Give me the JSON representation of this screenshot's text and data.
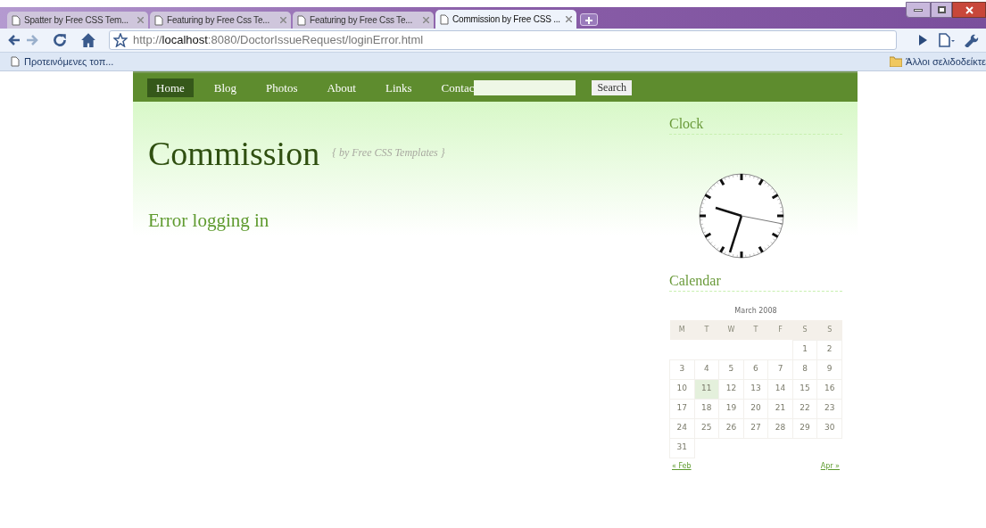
{
  "browser": {
    "tabs": [
      {
        "label": "Spatter by Free CSS Tem...",
        "selected": false
      },
      {
        "label": "Featuring by Free Css Te...",
        "selected": false
      },
      {
        "label": "Featuring by Free Css Te...",
        "selected": false
      },
      {
        "label": "Commission by Free CSS ...",
        "selected": true
      }
    ],
    "address": {
      "scheme": "http://",
      "host": "localhost",
      "rest": ":8080/DoctorIssueRequest/loginError.html"
    },
    "bookmarks": [
      {
        "label": "Προτεινόμενες τοπ..."
      }
    ],
    "other_bookmarks": "Άλλοι σελιδοδείκτε"
  },
  "page": {
    "nav": [
      {
        "label": "Home",
        "selected": true
      },
      {
        "label": "Blog",
        "selected": false
      },
      {
        "label": "Photos",
        "selected": false
      },
      {
        "label": "About",
        "selected": false
      },
      {
        "label": "Links",
        "selected": false
      },
      {
        "label": "Contac",
        "selected": false
      }
    ],
    "search_button": "Search",
    "logo": "Commission",
    "tagline": "{ by Free CSS Templates }",
    "heading": "Error logging in",
    "sidebar": {
      "clock_title": "Clock",
      "calendar_title": "Calendar",
      "calendar": {
        "caption": "March 2008",
        "weekdays": [
          "M",
          "T",
          "W",
          "T",
          "F",
          "S",
          "S"
        ],
        "weeks": [
          [
            {
              "day": "1",
              "selected": false
            },
            {
              "day": "2",
              "selected": false
            }
          ],
          [
            {
              "day": "3",
              "selected": false
            },
            {
              "day": "4",
              "selected": false
            },
            {
              "day": "5",
              "selected": false
            },
            {
              "day": "6",
              "selected": false
            },
            {
              "day": "7",
              "selected": false
            },
            {
              "day": "8",
              "selected": false
            },
            {
              "day": "9",
              "selected": false
            }
          ],
          [
            {
              "day": "10",
              "selected": false
            },
            {
              "day": "11",
              "selected": true
            },
            {
              "day": "12",
              "selected": false
            },
            {
              "day": "13",
              "selected": false
            },
            {
              "day": "14",
              "selected": false
            },
            {
              "day": "15",
              "selected": false
            },
            {
              "day": "16",
              "selected": false
            }
          ],
          [
            {
              "day": "17",
              "selected": false
            },
            {
              "day": "18",
              "selected": false
            },
            {
              "day": "19",
              "selected": false
            },
            {
              "day": "20",
              "selected": false
            },
            {
              "day": "21",
              "selected": false
            },
            {
              "day": "22",
              "selected": false
            },
            {
              "day": "23",
              "selected": false
            }
          ],
          [
            {
              "day": "24",
              "selected": false
            },
            {
              "day": "25",
              "selected": false
            },
            {
              "day": "26",
              "selected": false
            },
            {
              "day": "27",
              "selected": false
            },
            {
              "day": "28",
              "selected": false
            },
            {
              "day": "29",
              "selected": false
            },
            {
              "day": "30",
              "selected": false
            }
          ],
          [
            {
              "day": "31",
              "selected": false
            }
          ]
        ],
        "prev": "« Feb",
        "next": "Apr »"
      }
    }
  }
}
